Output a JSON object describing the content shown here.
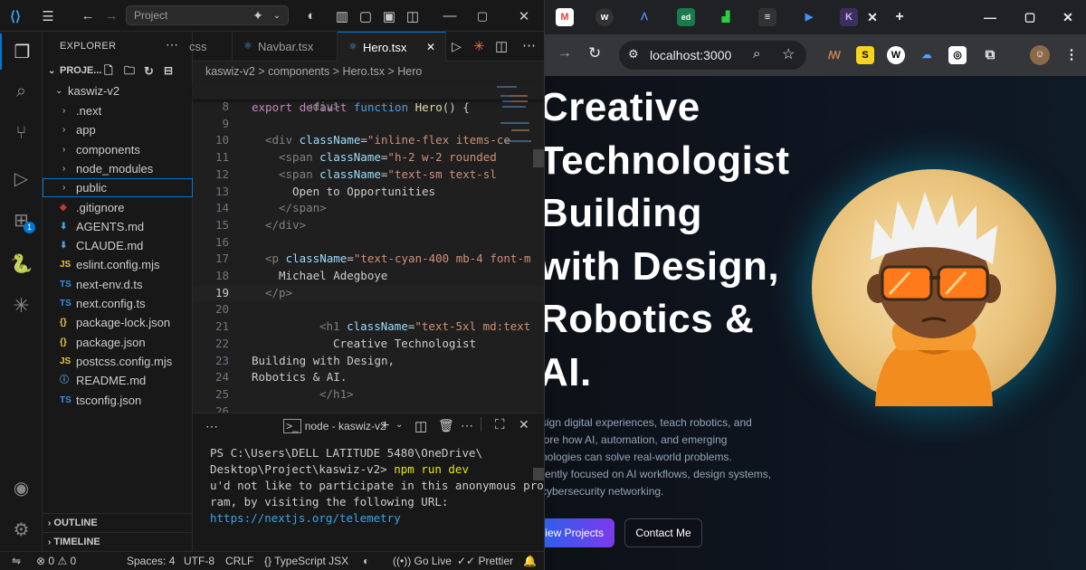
{
  "vscode": {
    "title_search": "Project",
    "explorer_title": "EXPLORER",
    "project_label": "PROJE...",
    "root_folder": "kaswiz-v2",
    "tree": [
      {
        "name": ".next",
        "kind": "folder"
      },
      {
        "name": "app",
        "kind": "folder"
      },
      {
        "name": "components",
        "kind": "folder"
      },
      {
        "name": "node_modules",
        "kind": "folder"
      },
      {
        "name": "public",
        "kind": "folder"
      },
      {
        "name": ".gitignore",
        "kind": "file"
      },
      {
        "name": "AGENTS.md",
        "kind": "file"
      },
      {
        "name": "CLAUDE.md",
        "kind": "file"
      },
      {
        "name": "eslint.config.mjs",
        "kind": "file"
      },
      {
        "name": "next-env.d.ts",
        "kind": "file"
      },
      {
        "name": "next.config.ts",
        "kind": "file"
      },
      {
        "name": "package-lock.json",
        "kind": "file"
      },
      {
        "name": "package.json",
        "kind": "file"
      },
      {
        "name": "postcss.config.mjs",
        "kind": "file"
      },
      {
        "name": "README.md",
        "kind": "file"
      },
      {
        "name": "tsconfig.json",
        "kind": "file"
      }
    ],
    "file_icons": [
      "",
      "",
      "",
      "",
      "",
      "◆",
      "⬇",
      "⬇",
      "JS",
      "TS",
      "TS",
      "{}",
      "{}",
      "JS",
      "ⓘ",
      "TS"
    ],
    "outline_label": "OUTLINE",
    "timeline_label": "TIMELINE",
    "extensions_badge": "1",
    "tabs": [
      "css",
      "Navbar.tsx",
      "Hero.tsx"
    ],
    "breadcrumb": "kaswiz-v2 > components > Hero.tsx > Hero",
    "sticky_line": "export default function Hero() {",
    "line_numbers": [
      "8",
      "9",
      "10",
      "11",
      "12",
      "13",
      "14",
      "15",
      "16",
      "17",
      "18",
      "19",
      "20",
      "21",
      "22",
      "23",
      "24",
      "25",
      "26"
    ],
    "current_line": "19",
    "code": {
      "l8": "<div>",
      "l10a": "<div ",
      "l10b": "className",
      "l10c": "=",
      "l10d": "\"inline-flex items-ce",
      "l11a": "<span ",
      "l11b": "className",
      "l11c": "=",
      "l11d": "\"h-2 w-2 rounded",
      "l12a": "<span ",
      "l12b": "className",
      "l12c": "=",
      "l12d": "\"text-sm text-sl",
      "l13": "Open to Opportunities",
      "l14": "</span>",
      "l15": "</div>",
      "l17a": "<p ",
      "l17b": "className",
      "l17c": "=",
      "l17d": "\"text-cyan-400 mb-4 font-m",
      "l18": "Michael Adegboye",
      "l19": "</p>",
      "l21a": "<h1 ",
      "l21b": "className",
      "l21c": "=",
      "l21d": "\"text-5xl md:text",
      "l22": "Creative Technologist",
      "l23": "Building with Design,",
      "l24": "Robotics & AI.",
      "l25": "</h1>"
    },
    "terminal_tab": "node - kaswiz-v2",
    "terminal": {
      "line1": "PS C:\\Users\\DELL LATITUDE 5480\\OneDrive\\",
      "line2a": "Desktop\\Project\\kaswiz-v2> ",
      "line2b": "npm run dev",
      "line3": "u'd not like to participate in this anonymous prog",
      "line4": "ram, by visiting the following URL:",
      "line5": "https://nextjs.org/telemetry"
    },
    "status": {
      "errors": "0",
      "warnings": "0",
      "spaces": "Spaces: 4",
      "encoding": "UTF-8",
      "eol": "CRLF",
      "language": "TypeScript JSX",
      "golive": "Go Live",
      "prettier": "Prettier"
    }
  },
  "browser": {
    "url": "localhost:3000",
    "hero_lines": [
      "Creative",
      "Technologist",
      "Building",
      "with Design,",
      "Robotics &",
      "AI."
    ],
    "description": [
      "sign digital experiences, teach robotics, and",
      "lore how AI, automation, and emerging",
      "nologies can solve real-world problems.",
      "rently focused on AI workflows, design systems,",
      "cybersecurity networking."
    ],
    "primary_button": "View Projects",
    "secondary_button": "Contact Me"
  },
  "colors": {
    "accent": "#0078d4",
    "cta_gradient_start": "#2563eb",
    "cta_gradient_end": "#7c3aed",
    "hoodie": "#f28c1e",
    "glasses": "#ff7a1a"
  }
}
